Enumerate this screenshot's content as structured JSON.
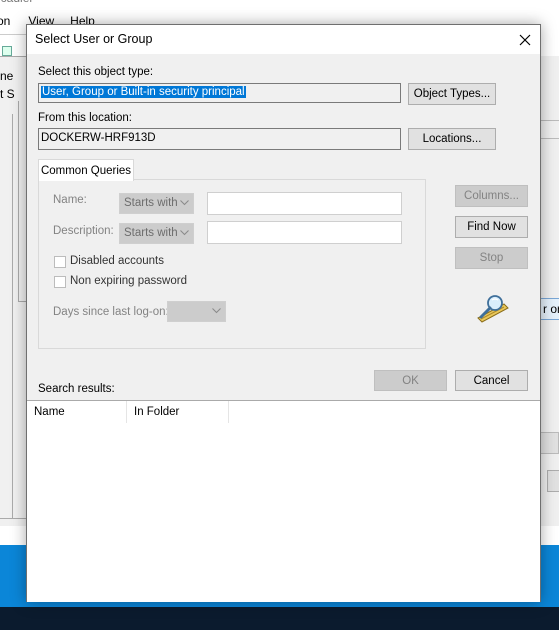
{
  "background_window": {
    "title_fragment": "ncadlel",
    "menu_items": [
      "on",
      "View",
      "Help"
    ],
    "left_fragments": [
      "ne",
      "t S"
    ],
    "right_button_fragment": "r or"
  },
  "dialog": {
    "title": "Select User or Group",
    "object_type_label": "Select this object type:",
    "object_type_value": "User, Group or Built-in security principal",
    "object_types_button": "Object Types...",
    "location_label": "From this location:",
    "location_value": "DOCKERW-HRF913D",
    "locations_button": "Locations...",
    "tab_label": "Common Queries",
    "name_label": "Name:",
    "name_mode": "Starts with",
    "description_label": "Description:",
    "description_mode": "Starts with",
    "disabled_accounts_label": "Disabled accounts",
    "non_expiring_label": "Non expiring password",
    "days_since_label": "Days since last log-on:",
    "columns_button": "Columns...",
    "find_now_button": "Find Now",
    "stop_button": "Stop",
    "ok_button": "OK",
    "cancel_button": "Cancel",
    "search_results_label": "Search results:",
    "result_columns": [
      "Name",
      "In Folder"
    ]
  },
  "colors": {
    "selection": "#0078d7",
    "taskbar": "#0b86d8",
    "dialog_bg": "#f0f0f0"
  },
  "icons": {
    "close": "close-icon",
    "search": "search-magnifier-icon"
  }
}
